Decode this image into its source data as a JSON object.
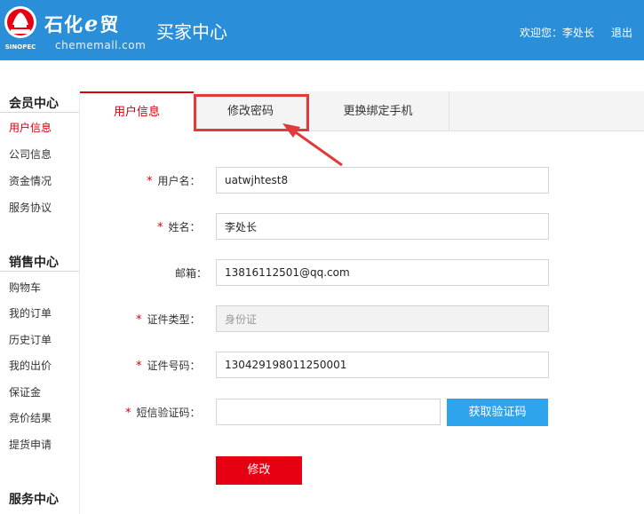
{
  "header": {
    "brand_part1": "石化",
    "brand_e": "e",
    "brand_part2": "贸",
    "domain": "chememall.com",
    "logo_text": "SINOPEC",
    "center_title": "买家中心",
    "welcome": "欢迎您：李处长",
    "logout": "退出"
  },
  "sidebar": {
    "member": {
      "title": "会员中心",
      "items": [
        "用户信息",
        "公司信息",
        "资金情况",
        "服务协议"
      ]
    },
    "sales": {
      "title": "销售中心",
      "items": [
        "购物车",
        "我的订单",
        "历史订单",
        "我的出价",
        "保证金",
        "竞价结果",
        "提货申请"
      ]
    },
    "service": {
      "title": "服务中心"
    }
  },
  "tabs": [
    "用户信息",
    "修改密码",
    "更换绑定手机"
  ],
  "form": {
    "required_mark": "*",
    "username": {
      "label": "用户名：",
      "value": "uatwjhtest8"
    },
    "name": {
      "label": "姓名：",
      "value": "李处长"
    },
    "email": {
      "label": "邮箱：",
      "value": "13816112501@qq.com"
    },
    "id_type": {
      "label": "证件类型：",
      "value": "身份证"
    },
    "id_number": {
      "label": "证件号码：",
      "value": "130429198011250001"
    },
    "sms_code": {
      "label": "短信验证码：",
      "value": ""
    },
    "sms_button": "获取验证码",
    "submit": "修改"
  },
  "colors": {
    "header_bg": "#2a8fd8",
    "accent_red": "#d6000f",
    "sms_button_bg": "#2ea4ee",
    "submit_bg": "#e60012",
    "highlight": "#e23a3a"
  }
}
